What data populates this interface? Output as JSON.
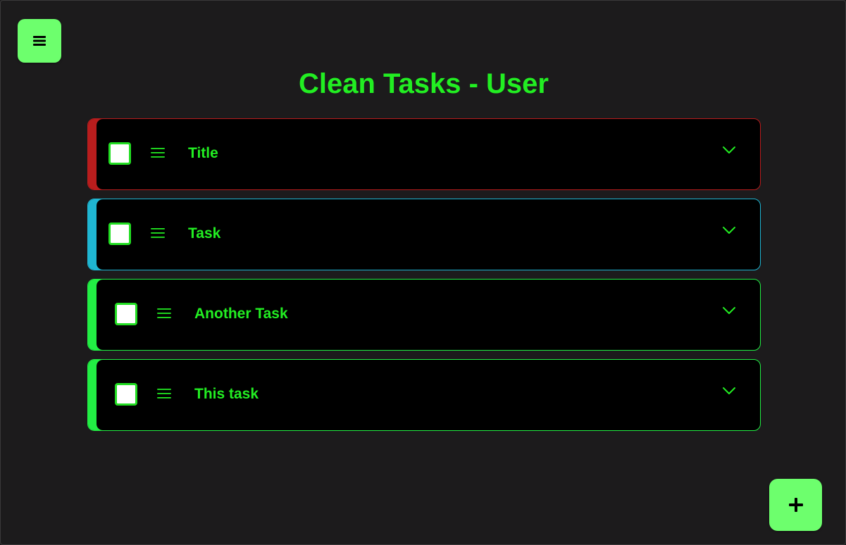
{
  "header": {
    "title": "Clean Tasks - User"
  },
  "colors": {
    "background": "#1c1b1c",
    "accent": "#6dff6d",
    "text": "#22ee22",
    "card_background": "#000000"
  },
  "icons": {
    "menu": "hamburger-menu-icon",
    "add": "plus-icon",
    "drag": "drag-handle-icon",
    "expand": "chevron-down-icon"
  },
  "tasks": [
    {
      "title": "Title",
      "checked": false,
      "priority_color": "#b81d1d"
    },
    {
      "title": "Task",
      "checked": false,
      "priority_color": "#1fb6d2"
    },
    {
      "title": "Another Task",
      "checked": false,
      "priority_color": "#22ee44"
    },
    {
      "title": "This task",
      "checked": false,
      "priority_color": "#22ee44"
    }
  ]
}
